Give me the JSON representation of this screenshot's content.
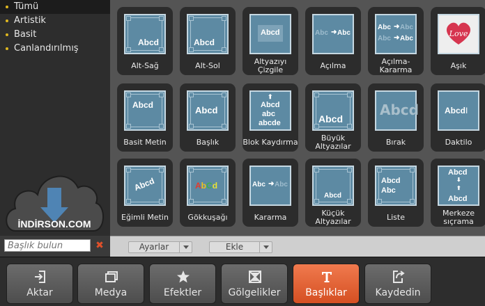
{
  "sidebar": {
    "categories": [
      {
        "label": "Tümü",
        "active": true
      },
      {
        "label": "Artistik",
        "active": false
      },
      {
        "label": "Basit",
        "active": false
      },
      {
        "label": "Canlandırılmış",
        "active": false
      }
    ],
    "watermark_text": "İNDİRSON.COM",
    "search_placeholder": "Başlık bulun"
  },
  "titles": [
    {
      "label": "Alt-Sağ",
      "preview": "Abcd"
    },
    {
      "label": "Alt-Sol",
      "preview": "Abcd"
    },
    {
      "label": "Altyazıyı Çizgile",
      "preview": "Abcd"
    },
    {
      "label": "Açılma",
      "preview": "Abc ➜ Abc"
    },
    {
      "label": "Açılma-Kararma",
      "preview": "Abc ➜ Abc"
    },
    {
      "label": "Aşık",
      "preview": "Love"
    },
    {
      "label": "Basit Metin",
      "preview": "Abcd"
    },
    {
      "label": "Başlık",
      "preview": "Abcd"
    },
    {
      "label": "Blok Kaydırma",
      "preview": "Abcd abc abcde"
    },
    {
      "label": "Büyük Altyazılar",
      "preview": "Abcd"
    },
    {
      "label": "Bırak",
      "preview": "Abcd"
    },
    {
      "label": "Daktilo",
      "preview": "Abcd"
    },
    {
      "label": "Eğimli Metin",
      "preview": "Abcd"
    },
    {
      "label": "Gökkuşağı",
      "preview": "AbCd"
    },
    {
      "label": "Kararma",
      "preview": "Abc ➜ Abc"
    },
    {
      "label": "Küçük Altyazılar",
      "preview": "Abcd"
    },
    {
      "label": "Liste",
      "preview": "Abcd Abc"
    },
    {
      "label": "Merkeze sıçrama",
      "preview": "Abcd Abcd"
    }
  ],
  "toolbar": {
    "settings_label": "Ayarlar",
    "add_label": "Ekle"
  },
  "bottom_tabs": [
    {
      "label": "Aktar",
      "icon": "import-icon",
      "active": false
    },
    {
      "label": "Medya",
      "icon": "media-icon",
      "active": false
    },
    {
      "label": "Efektler",
      "icon": "star-icon",
      "active": false
    },
    {
      "label": "Gölgelikler",
      "icon": "transition-icon",
      "active": false
    },
    {
      "label": "Başlıklar",
      "icon": "title-t-icon",
      "active": true
    },
    {
      "label": "Kaydedin",
      "icon": "export-icon",
      "active": false
    }
  ],
  "colors": {
    "accent": "#e0602f",
    "tile_blue": "#5d8aa3",
    "category_dot": "#e0b820"
  }
}
